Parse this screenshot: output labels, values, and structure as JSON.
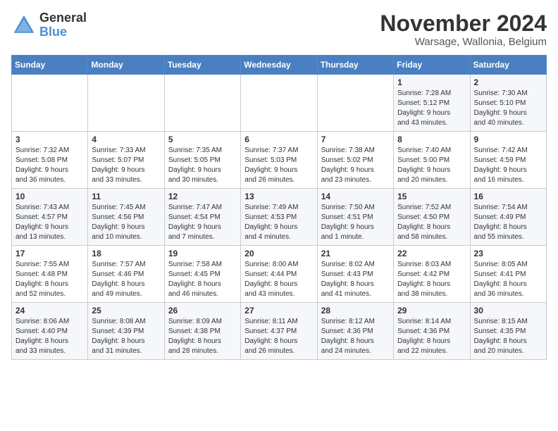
{
  "logo": {
    "general": "General",
    "blue": "Blue"
  },
  "title": "November 2024",
  "location": "Warsage, Wallonia, Belgium",
  "weekdays": [
    "Sunday",
    "Monday",
    "Tuesday",
    "Wednesday",
    "Thursday",
    "Friday",
    "Saturday"
  ],
  "weeks": [
    [
      {
        "day": "",
        "info": ""
      },
      {
        "day": "",
        "info": ""
      },
      {
        "day": "",
        "info": ""
      },
      {
        "day": "",
        "info": ""
      },
      {
        "day": "",
        "info": ""
      },
      {
        "day": "1",
        "info": "Sunrise: 7:28 AM\nSunset: 5:12 PM\nDaylight: 9 hours\nand 43 minutes."
      },
      {
        "day": "2",
        "info": "Sunrise: 7:30 AM\nSunset: 5:10 PM\nDaylight: 9 hours\nand 40 minutes."
      }
    ],
    [
      {
        "day": "3",
        "info": "Sunrise: 7:32 AM\nSunset: 5:08 PM\nDaylight: 9 hours\nand 36 minutes."
      },
      {
        "day": "4",
        "info": "Sunrise: 7:33 AM\nSunset: 5:07 PM\nDaylight: 9 hours\nand 33 minutes."
      },
      {
        "day": "5",
        "info": "Sunrise: 7:35 AM\nSunset: 5:05 PM\nDaylight: 9 hours\nand 30 minutes."
      },
      {
        "day": "6",
        "info": "Sunrise: 7:37 AM\nSunset: 5:03 PM\nDaylight: 9 hours\nand 26 minutes."
      },
      {
        "day": "7",
        "info": "Sunrise: 7:38 AM\nSunset: 5:02 PM\nDaylight: 9 hours\nand 23 minutes."
      },
      {
        "day": "8",
        "info": "Sunrise: 7:40 AM\nSunset: 5:00 PM\nDaylight: 9 hours\nand 20 minutes."
      },
      {
        "day": "9",
        "info": "Sunrise: 7:42 AM\nSunset: 4:59 PM\nDaylight: 9 hours\nand 16 minutes."
      }
    ],
    [
      {
        "day": "10",
        "info": "Sunrise: 7:43 AM\nSunset: 4:57 PM\nDaylight: 9 hours\nand 13 minutes."
      },
      {
        "day": "11",
        "info": "Sunrise: 7:45 AM\nSunset: 4:56 PM\nDaylight: 9 hours\nand 10 minutes."
      },
      {
        "day": "12",
        "info": "Sunrise: 7:47 AM\nSunset: 4:54 PM\nDaylight: 9 hours\nand 7 minutes."
      },
      {
        "day": "13",
        "info": "Sunrise: 7:49 AM\nSunset: 4:53 PM\nDaylight: 9 hours\nand 4 minutes."
      },
      {
        "day": "14",
        "info": "Sunrise: 7:50 AM\nSunset: 4:51 PM\nDaylight: 9 hours\nand 1 minute."
      },
      {
        "day": "15",
        "info": "Sunrise: 7:52 AM\nSunset: 4:50 PM\nDaylight: 8 hours\nand 58 minutes."
      },
      {
        "day": "16",
        "info": "Sunrise: 7:54 AM\nSunset: 4:49 PM\nDaylight: 8 hours\nand 55 minutes."
      }
    ],
    [
      {
        "day": "17",
        "info": "Sunrise: 7:55 AM\nSunset: 4:48 PM\nDaylight: 8 hours\nand 52 minutes."
      },
      {
        "day": "18",
        "info": "Sunrise: 7:57 AM\nSunset: 4:46 PM\nDaylight: 8 hours\nand 49 minutes."
      },
      {
        "day": "19",
        "info": "Sunrise: 7:58 AM\nSunset: 4:45 PM\nDaylight: 8 hours\nand 46 minutes."
      },
      {
        "day": "20",
        "info": "Sunrise: 8:00 AM\nSunset: 4:44 PM\nDaylight: 8 hours\nand 43 minutes."
      },
      {
        "day": "21",
        "info": "Sunrise: 8:02 AM\nSunset: 4:43 PM\nDaylight: 8 hours\nand 41 minutes."
      },
      {
        "day": "22",
        "info": "Sunrise: 8:03 AM\nSunset: 4:42 PM\nDaylight: 8 hours\nand 38 minutes."
      },
      {
        "day": "23",
        "info": "Sunrise: 8:05 AM\nSunset: 4:41 PM\nDaylight: 8 hours\nand 36 minutes."
      }
    ],
    [
      {
        "day": "24",
        "info": "Sunrise: 8:06 AM\nSunset: 4:40 PM\nDaylight: 8 hours\nand 33 minutes."
      },
      {
        "day": "25",
        "info": "Sunrise: 8:08 AM\nSunset: 4:39 PM\nDaylight: 8 hours\nand 31 minutes."
      },
      {
        "day": "26",
        "info": "Sunrise: 8:09 AM\nSunset: 4:38 PM\nDaylight: 8 hours\nand 28 minutes."
      },
      {
        "day": "27",
        "info": "Sunrise: 8:11 AM\nSunset: 4:37 PM\nDaylight: 8 hours\nand 26 minutes."
      },
      {
        "day": "28",
        "info": "Sunrise: 8:12 AM\nSunset: 4:36 PM\nDaylight: 8 hours\nand 24 minutes."
      },
      {
        "day": "29",
        "info": "Sunrise: 8:14 AM\nSunset: 4:36 PM\nDaylight: 8 hours\nand 22 minutes."
      },
      {
        "day": "30",
        "info": "Sunrise: 8:15 AM\nSunset: 4:35 PM\nDaylight: 8 hours\nand 20 minutes."
      }
    ]
  ]
}
